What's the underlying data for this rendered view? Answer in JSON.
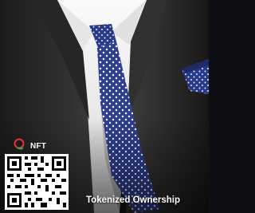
{
  "badge": {
    "label": "NFT",
    "icon": "nft-logo-icon"
  },
  "caption": "Tokenized Ownership",
  "qr": {
    "icon": "qr-code-icon"
  },
  "colors": {
    "tie_blue": "#2f3f95",
    "tie_dots": "#ffffff",
    "suit": "#2a2a2a",
    "shirt": "#f2f2f2",
    "background": "#0d0f14",
    "badge_red": "#e3342f",
    "badge_green": "#2fa84f"
  }
}
